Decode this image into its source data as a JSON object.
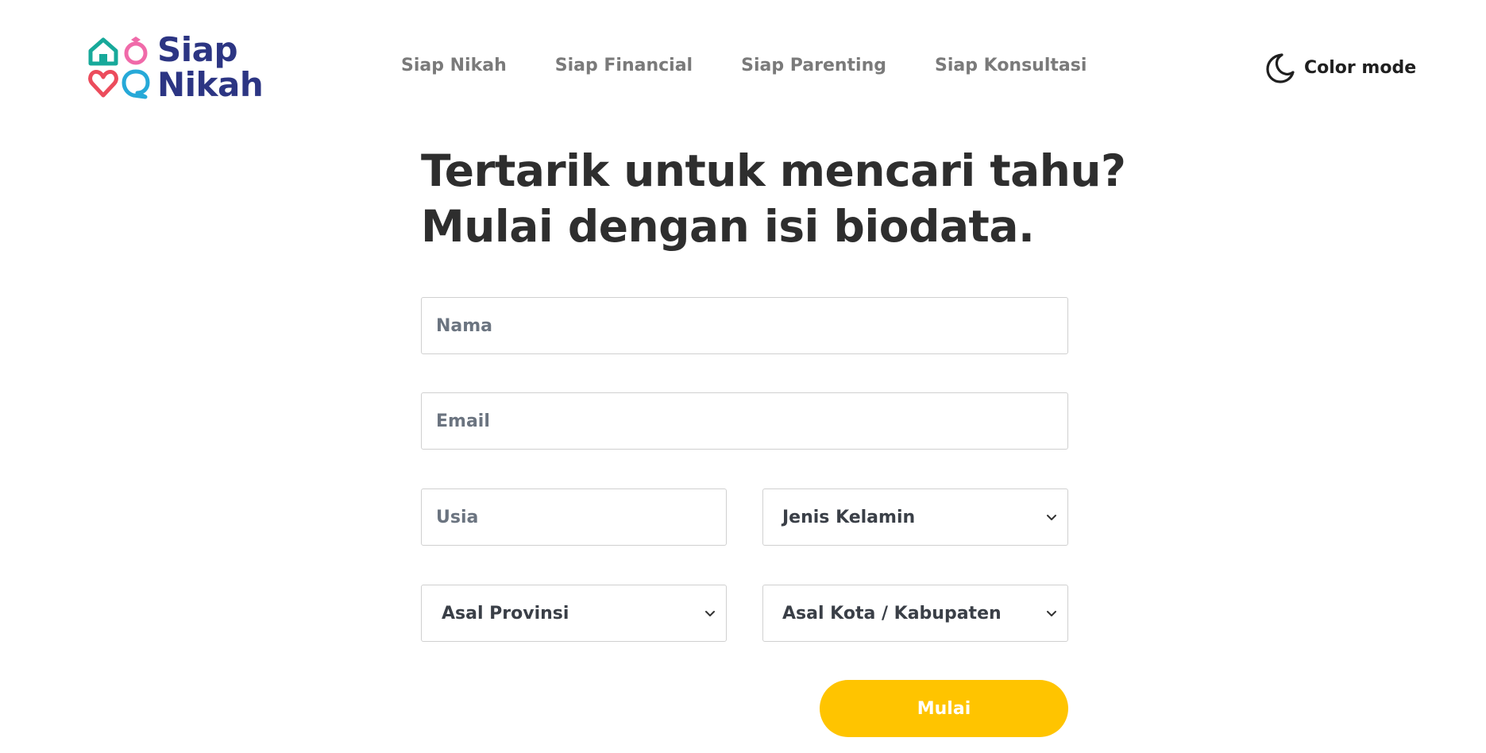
{
  "brand": {
    "name_line1": "Siap",
    "name_line2": "Nikah",
    "colors": {
      "primary": "#2c3583",
      "teal": "#17a99a",
      "pink": "#f06aa9",
      "red": "#ec4c5c",
      "cyan": "#26a9d8",
      "accent": "#ffc400"
    }
  },
  "nav": {
    "items": [
      "Siap Nikah",
      "Siap Financial",
      "Siap Parenting",
      "Siap Konsultasi"
    ]
  },
  "color_mode": {
    "label": "Color mode",
    "icon": "moon-icon"
  },
  "heading": {
    "line1": "Tertarik untuk mencari tahu?",
    "line2": "Mulai dengan isi biodata."
  },
  "form": {
    "name_placeholder": "Nama",
    "email_placeholder": "Email",
    "age_placeholder": "Usia",
    "gender_select": "Jenis Kelamin",
    "province_select": "Asal Provinsi",
    "city_select": "Asal Kota / Kabupaten",
    "submit_label": "Mulai"
  }
}
